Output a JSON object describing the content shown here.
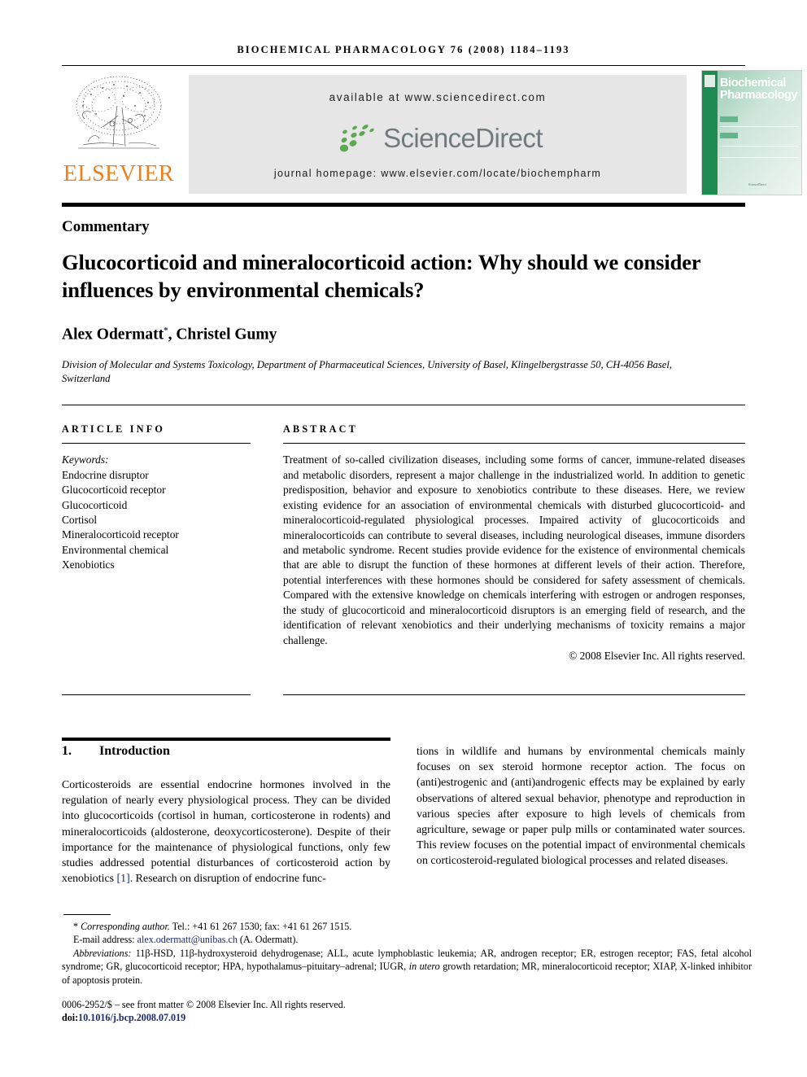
{
  "running_head": "BIOCHEMICAL PHARMACOLOGY 76 (2008) 1184–1193",
  "masthead": {
    "available_at": "available at www.sciencedirect.com",
    "sciencedirect_logo_text": "ScienceDirect",
    "journal_homepage": "journal homepage: www.elsevier.com/locate/biochempharm",
    "publisher_name": "ELSEVIER",
    "publisher_color": "#F07F1A",
    "cover": {
      "title_line1": "Biochemical",
      "title_line2": "Pharmacology",
      "band_color": "#1f8a52",
      "footer_note": "ScienceDirect"
    }
  },
  "article": {
    "type": "Commentary",
    "title": "Glucocorticoid and mineralocorticoid action: Why should we consider influences by environmental chemicals?",
    "authors": "Alex Odermatt",
    "corresponding_marker": "*",
    "authors_rest": ", Christel Gumy",
    "affiliation": "Division of Molecular and Systems Toxicology, Department of Pharmaceutical Sciences, University of Basel, Klingelbergstrasse 50, CH-4056 Basel, Switzerland"
  },
  "article_info": {
    "heading": "ARTICLE INFO",
    "keywords_label": "Keywords:",
    "keywords": [
      "Endocrine disruptor",
      "Glucocorticoid receptor",
      "Glucocorticoid",
      "Cortisol",
      "Mineralocorticoid receptor",
      "Environmental chemical",
      "Xenobiotics"
    ]
  },
  "abstract": {
    "heading": "ABSTRACT",
    "text": "Treatment of so-called civilization diseases, including some forms of cancer, immune-related diseases and metabolic disorders, represent a major challenge in the industrialized world. In addition to genetic predisposition, behavior and exposure to xenobiotics contribute to these diseases. Here, we review existing evidence for an association of environmental chemicals with disturbed glucocorticoid- and mineralocorticoid-regulated physiological processes. Impaired activity of glucocorticoids and mineralocorticoids can contribute to several diseases, including neurological diseases, immune disorders and metabolic syndrome. Recent studies provide evidence for the existence of environmental chemicals that are able to disrupt the function of these hormones at different levels of their action. Therefore, potential interferences with these hormones should be considered for safety assessment of chemicals. Compared with the extensive knowledge on chemicals interfering with estrogen or androgen responses, the study of glucocorticoid and mineralocorticoid disruptors is an emerging field of research, and the identification of relevant xenobiotics and their underlying mechanisms of toxicity remains a major challenge.",
    "copyright": "© 2008 Elsevier Inc. All rights reserved."
  },
  "introduction": {
    "number": "1.",
    "heading": "Introduction",
    "col_left_part1": "Corticosteroids are essential endocrine hormones involved in the regulation of nearly every physiological process. They can be divided into glucocorticoids (cortisol in human, corticosterone in rodents) and mineralocorticoids (aldosterone, deoxycorticosterone). Despite of their importance for the maintenance of physiological functions, only few studies addressed potential disturbances of corticosteroid action by xenobiotics ",
    "ref_citation": "[1]",
    "col_left_part2": ". Research on disruption of endocrine func-",
    "col_right": "tions in wildlife and humans by environmental chemicals mainly focuses on sex steroid hormone receptor action. The focus on (anti)estrogenic and (anti)androgenic effects may be explained by early observations of altered sexual behavior, phenotype and reproduction in various species after exposure to high levels of chemicals from agriculture, sewage or paper pulp mills or contaminated water sources. This review focuses on the potential impact of environmental chemicals on corticosteroid-regulated biological processes and related diseases."
  },
  "footnotes": {
    "corresponding_marker": "*",
    "corresponding_author": "Corresponding author.",
    "corresponding_contact": " Tel.: +41 61 267 1530; fax: +41 61 267 1515.",
    "email_label": "E-mail address: ",
    "email": "alex.odermatt@unibas.ch",
    "email_suffix": " (A. Odermatt).",
    "abbreviations_label": "Abbreviations:",
    "abbreviations_part1": " 11β-HSD, 11β-hydroxysteroid dehydrogenase; ALL, acute lymphoblastic leukemia; AR, androgen receptor; ER, estrogen receptor; FAS, fetal alcohol syndrome; GR, glucocorticoid receptor; HPA, hypothalamus–pituitary–adrenal; IUGR, ",
    "abbreviations_italic": "in utero",
    "abbreviations_part2": " growth retardation; MR, mineralocorticoid receptor; XIAP, X-linked inhibitor of apoptosis protein.",
    "front_matter": "0006-2952/$ – see front matter © 2008 Elsevier Inc. All rights reserved.",
    "doi_label": "doi:",
    "doi_value": "10.1016/j.bcp.2008.07.019"
  }
}
